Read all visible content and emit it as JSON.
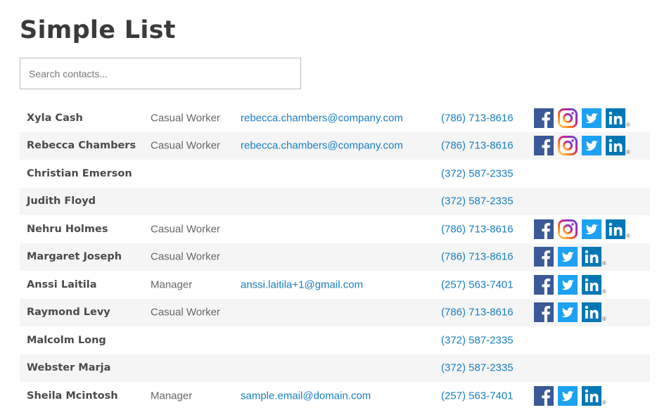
{
  "page": {
    "title": "Simple List"
  },
  "search": {
    "placeholder": "Search contacts..."
  },
  "colors": {
    "link": "#1a7fc1",
    "facebook": "#3b5998",
    "twitter": "#1da1f2",
    "linkedin": "#0077b5",
    "instagram_gradient": [
      "#feda75",
      "#fa7e1e",
      "#d62976",
      "#962fbf",
      "#4f5bd5"
    ]
  },
  "contacts": [
    {
      "name": "Xyla Cash",
      "role": "Casual Worker",
      "email": "rebecca.chambers@company.com",
      "phone": "(786) 713-8616",
      "social": [
        "facebook-icon",
        "instagram-icon",
        "twitter-icon",
        "linkedin-icon"
      ],
      "registered_mark": "®"
    },
    {
      "name": "Rebecca Chambers",
      "role": "Casual Worker",
      "email": "rebecca.chambers@company.com",
      "phone": "(786) 713-8616",
      "social": [
        "facebook-icon",
        "instagram-icon",
        "twitter-icon",
        "linkedin-icon"
      ],
      "registered_mark": "®"
    },
    {
      "name": "Christian Emerson",
      "role": "",
      "email": "",
      "phone": "(372) 587-2335",
      "social": [],
      "registered_mark": ""
    },
    {
      "name": "Judith Floyd",
      "role": "",
      "email": "",
      "phone": "(372) 587-2335",
      "social": [],
      "registered_mark": ""
    },
    {
      "name": "Nehru Holmes",
      "role": "Casual Worker",
      "email": "",
      "phone": "(786) 713-8616",
      "social": [
        "facebook-icon",
        "instagram-icon",
        "twitter-icon",
        "linkedin-icon"
      ],
      "registered_mark": "®"
    },
    {
      "name": "Margaret Joseph",
      "role": "Casual Worker",
      "email": "",
      "phone": "(786) 713-8616",
      "social": [
        "facebook-icon",
        "twitter-icon",
        "linkedin-icon"
      ],
      "registered_mark": "®"
    },
    {
      "name": "Anssi Laitila",
      "role": "Manager",
      "email": "anssi.laitila+1@gmail.com",
      "phone": "(257) 563-7401",
      "social": [
        "facebook-icon",
        "twitter-icon",
        "linkedin-icon"
      ],
      "registered_mark": "®"
    },
    {
      "name": "Raymond Levy",
      "role": "Casual Worker",
      "email": "",
      "phone": "(786) 713-8616",
      "social": [
        "facebook-icon",
        "twitter-icon",
        "linkedin-icon"
      ],
      "registered_mark": "®"
    },
    {
      "name": "Malcolm Long",
      "role": "",
      "email": "",
      "phone": "(372) 587-2335",
      "social": [],
      "registered_mark": ""
    },
    {
      "name": "Webster Marja",
      "role": "",
      "email": "",
      "phone": "(372) 587-2335",
      "social": [],
      "registered_mark": ""
    },
    {
      "name": "Sheila Mcintosh",
      "role": "Manager",
      "email": "sample.email@domain.com",
      "phone": "(257) 563-7401",
      "social": [
        "facebook-icon",
        "twitter-icon",
        "linkedin-icon"
      ],
      "registered_mark": "®"
    }
  ]
}
